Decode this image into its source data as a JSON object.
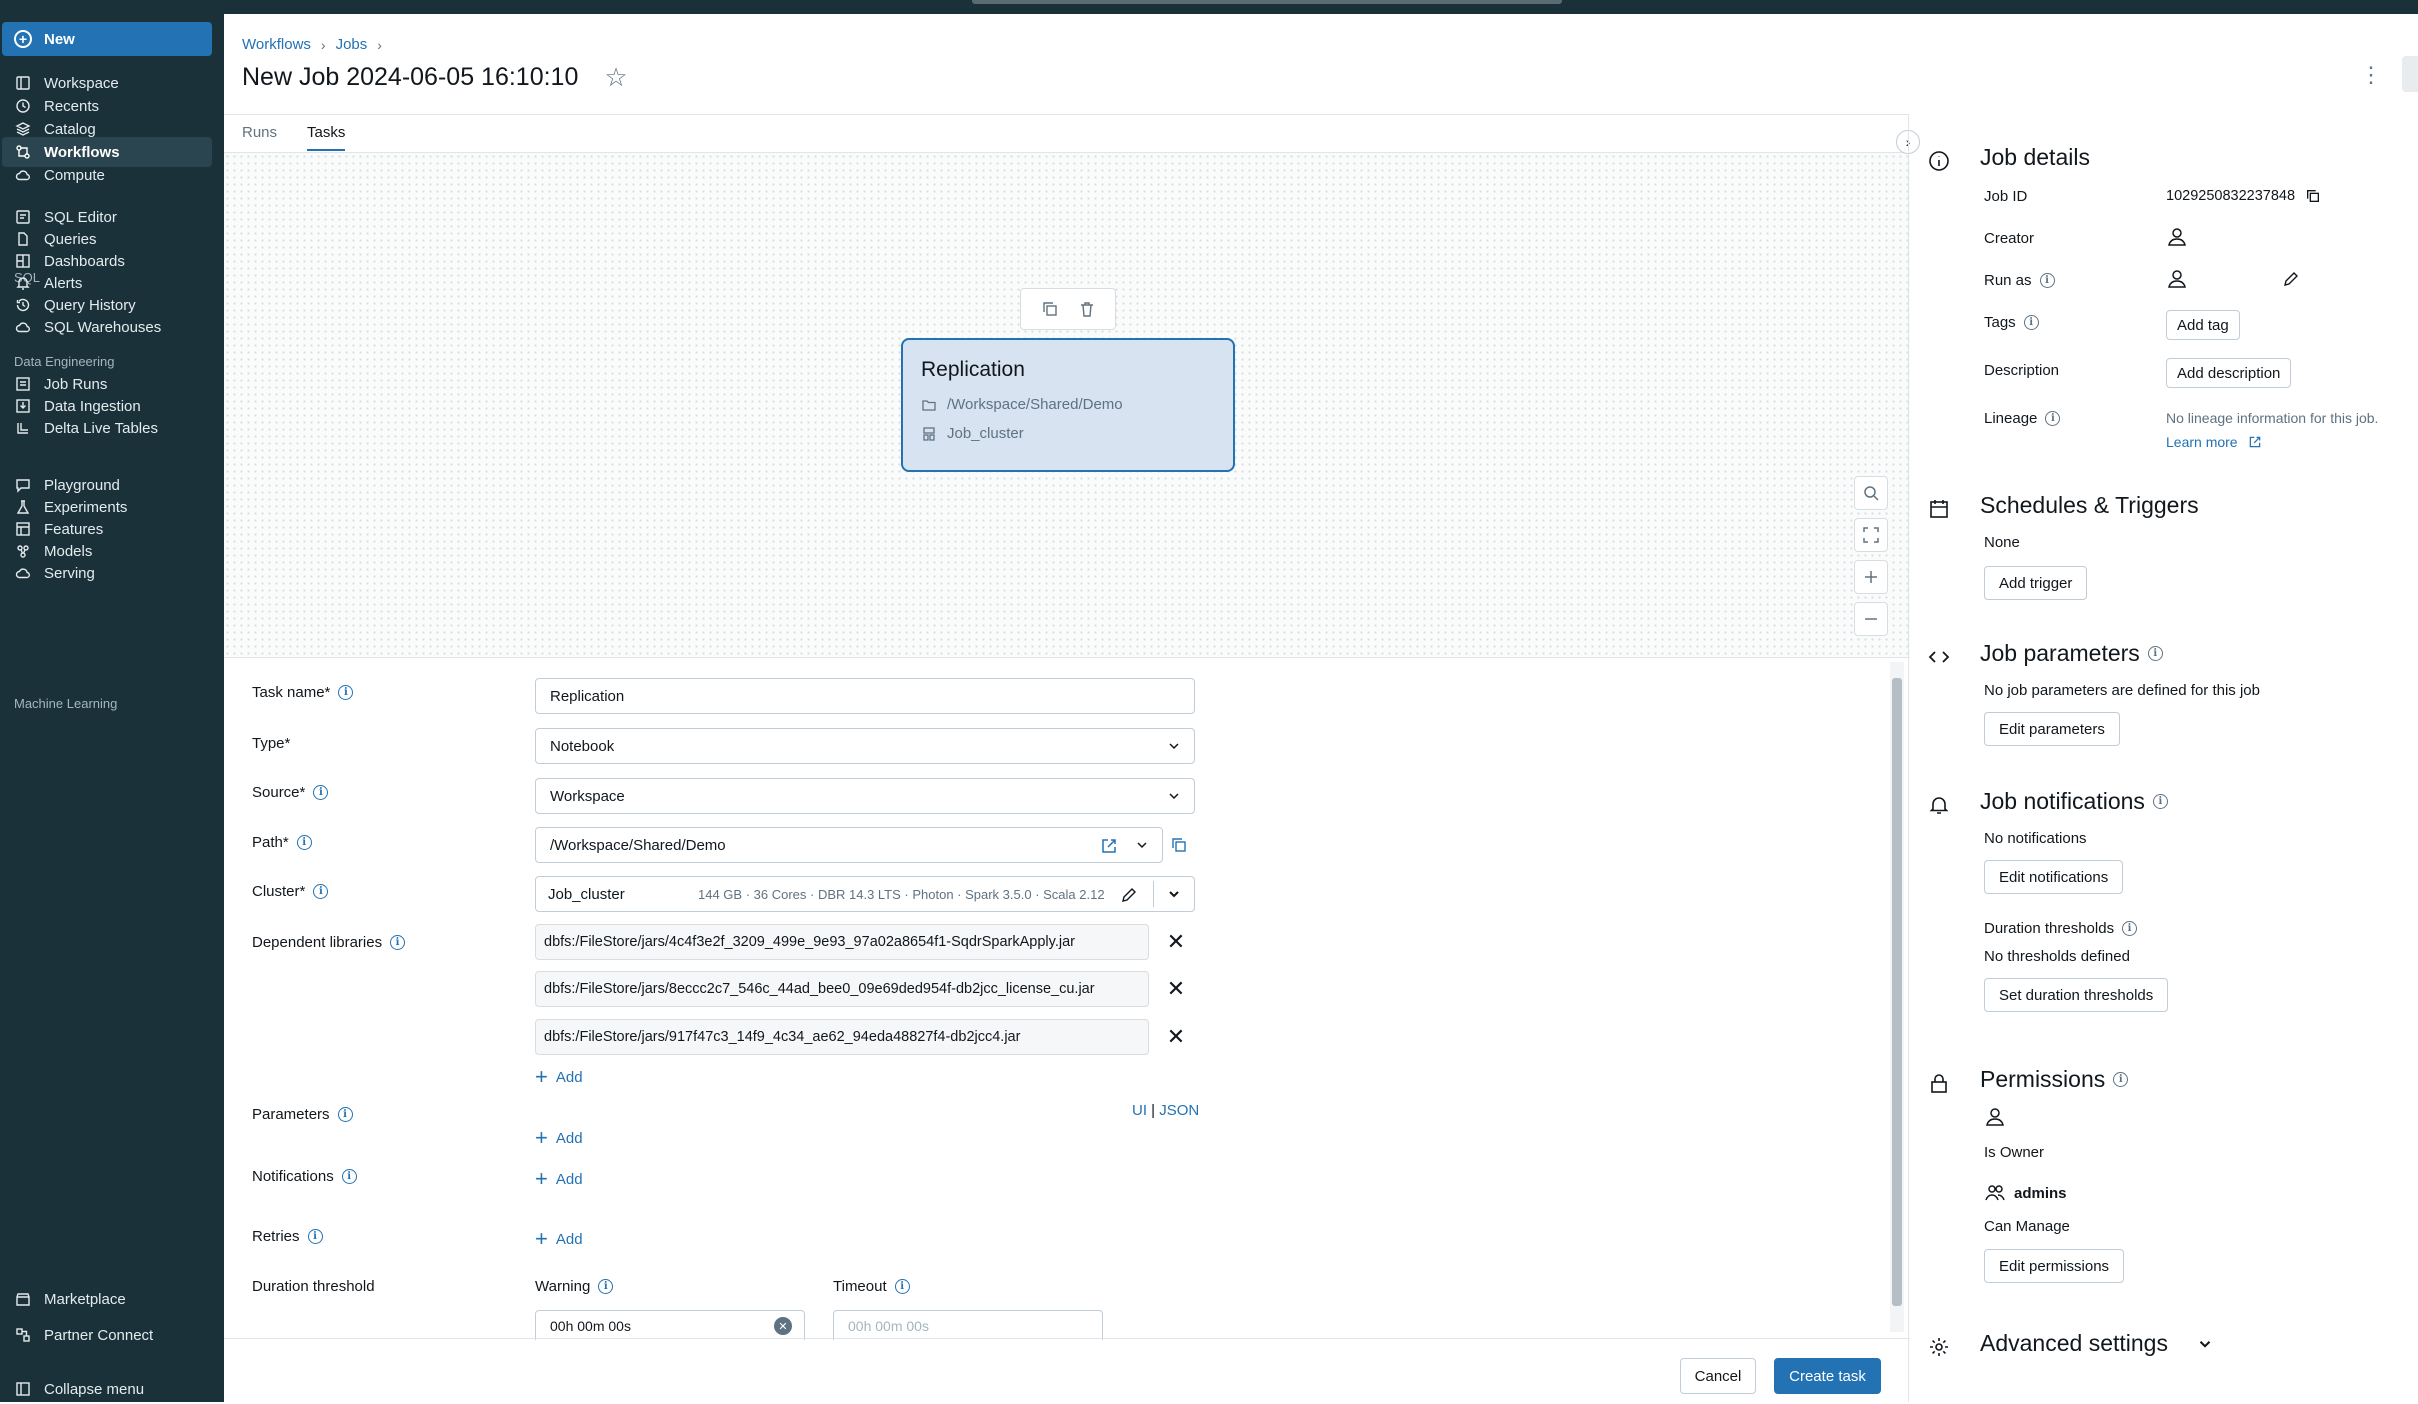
{
  "sidebar": {
    "new_label": "New",
    "items": [
      {
        "label": "Workspace",
        "icon": "workspace-icon"
      },
      {
        "label": "Recents",
        "icon": "clock-icon"
      },
      {
        "label": "Catalog",
        "icon": "catalog-icon"
      },
      {
        "label": "Workflows",
        "icon": "workflows-icon"
      },
      {
        "label": "Compute",
        "icon": "cloud-icon"
      }
    ],
    "sql_label": "SQL",
    "sql_items": [
      {
        "label": "SQL Editor"
      },
      {
        "label": "Queries"
      },
      {
        "label": "Dashboards"
      },
      {
        "label": "Alerts"
      },
      {
        "label": "Query History"
      },
      {
        "label": "SQL Warehouses"
      }
    ],
    "de_label": "Data Engineering",
    "de_items": [
      {
        "label": "Job Runs"
      },
      {
        "label": "Data Ingestion"
      },
      {
        "label": "Delta Live Tables"
      }
    ],
    "ml_label": "Machine Learning",
    "ml_items": [
      {
        "label": "Playground"
      },
      {
        "label": "Experiments"
      },
      {
        "label": "Features"
      },
      {
        "label": "Models"
      },
      {
        "label": "Serving"
      }
    ],
    "bottom_items": [
      {
        "label": "Marketplace"
      },
      {
        "label": "Partner Connect"
      }
    ],
    "collapse_label": "Collapse menu"
  },
  "header": {
    "breadcrumb": [
      "Workflows",
      "Jobs"
    ],
    "title": "New Job 2024-06-05 16:10:10",
    "tabs": [
      {
        "label": "Runs"
      },
      {
        "label": "Tasks"
      }
    ],
    "active_tab": "Tasks"
  },
  "canvas": {
    "task_name": "Replication",
    "path": "/Workspace/Shared/Demo",
    "cluster": "Job_cluster"
  },
  "form": {
    "task_name_label": "Task name*",
    "task_name_value": "Replication",
    "type_label": "Type*",
    "type_value": "Notebook",
    "source_label": "Source*",
    "source_value": "Workspace",
    "path_label": "Path*",
    "path_value": "/Workspace/Shared/Demo",
    "cluster_label": "Cluster*",
    "cluster_name": "Job_cluster",
    "cluster_details": "144 GB · 36 Cores · DBR 14.3 LTS · Photon · Spark 3.5.0 · Scala 2.12",
    "libraries_label": "Dependent libraries",
    "libraries": [
      "dbfs:/FileStore/jars/4c4f3e2f_3209_499e_9e93_97a02a8654f1-SqdrSparkApply.jar",
      "dbfs:/FileStore/jars/8eccc2c7_546c_44ad_bee0_09e69ded954f-db2jcc_license_cu.jar",
      "dbfs:/FileStore/jars/917f47c3_14f9_4c34_ae62_94eda48827f4-db2jcc4.jar"
    ],
    "add_label": "Add",
    "parameters_label": "Parameters",
    "ui_label": "UI",
    "json_label": "JSON",
    "notifications_label": "Notifications",
    "retries_label": "Retries",
    "duration_label": "Duration threshold",
    "warning_label": "Warning",
    "warning_value": "00h 00m 00s",
    "timeout_label": "Timeout",
    "timeout_placeholder": "00h 00m 00s",
    "cancel_label": "Cancel",
    "create_label": "Create task"
  },
  "details": {
    "title": "Job details",
    "job_id_label": "Job ID",
    "job_id": "1029250832237848",
    "creator_label": "Creator",
    "run_as_label": "Run as",
    "tags_label": "Tags",
    "add_tag": "Add tag",
    "description_label": "Description",
    "add_description": "Add description",
    "lineage_label": "Lineage",
    "lineage_text": "No lineage information for this job.",
    "learn_more": "Learn more"
  },
  "schedules": {
    "title": "Schedules & Triggers",
    "none_text": "None",
    "add_trigger": "Add trigger"
  },
  "job_params": {
    "title": "Job parameters",
    "text": "No job parameters are defined for this job",
    "edit": "Edit parameters"
  },
  "job_notifications": {
    "title": "Job notifications",
    "text": "No notifications",
    "edit": "Edit notifications",
    "duration_title": "Duration thresholds",
    "duration_text": "No thresholds defined",
    "duration_btn": "Set duration thresholds"
  },
  "permissions": {
    "title": "Permissions",
    "owner_role": "Is Owner",
    "group_name": "admins",
    "group_role": "Can Manage",
    "edit": "Edit permissions"
  },
  "advanced": {
    "title": "Advanced settings"
  },
  "colors": {
    "sidebar_bg": "#1b3139",
    "accent": "#2272b4",
    "node_fill": "#d7e3f0"
  }
}
